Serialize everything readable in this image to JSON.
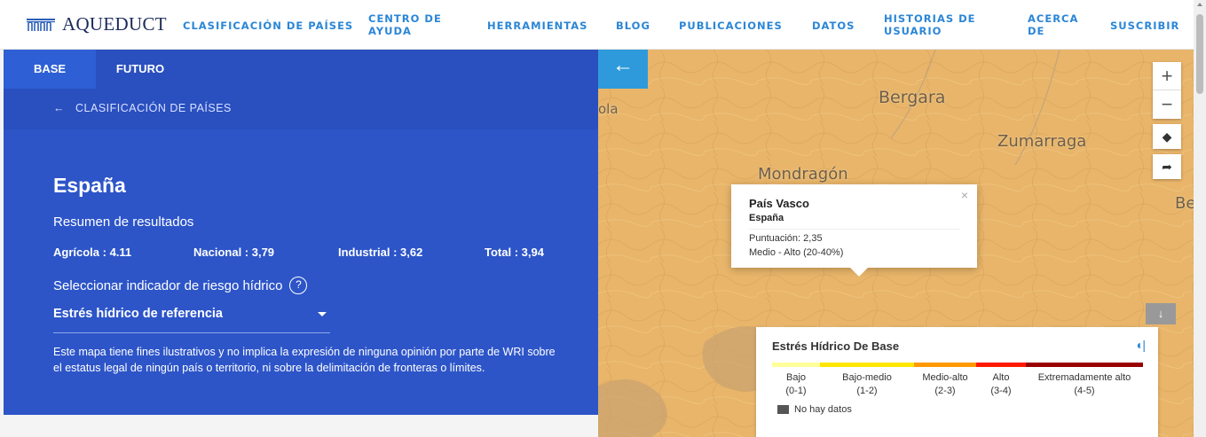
{
  "header": {
    "logo_text": "AQUEDUCT",
    "nav": [
      {
        "line1": "CLASIFICACIÓN DE PAÍSES",
        "line2": ""
      },
      {
        "line1": "CENTRO DE",
        "line2": "AYUDA"
      },
      {
        "line1": "HERRAMIENTAS",
        "line2": ""
      },
      {
        "line1": "BLOG",
        "line2": ""
      },
      {
        "line1": "PUBLICACIONES",
        "line2": ""
      },
      {
        "line1": "DATOS",
        "line2": ""
      },
      {
        "line1": "HISTORIAS DE",
        "line2": "USUARIO"
      },
      {
        "line1": "ACERCA",
        "line2": "DE"
      },
      {
        "line1": "SUSCRIBIR",
        "line2": ""
      }
    ]
  },
  "sidebar": {
    "tabs": [
      "BASE",
      "FUTURO"
    ],
    "back_arrow": "←",
    "back_label": "CLASIFICACIÓN DE PAÍSES",
    "country": "España",
    "summary_title": "Resumen de resultados",
    "scores": [
      {
        "label": "Agrícola : 4.11"
      },
      {
        "label": "Nacional : 3,79"
      },
      {
        "label": "Industrial : 3,62"
      },
      {
        "label": "Total : 3,94"
      }
    ],
    "indicator_label": "Seleccionar indicador de riesgo hídrico",
    "help_icon": "?",
    "selected_indicator": "Estrés hídrico de referencia",
    "disclaimer": "Este mapa tiene fines ilustrativos y no implica la expresión de ninguna opinión por parte de WRI sobre el estatus legal de ningún país o territorio, ni sobre la delimitación de fronteras o límites."
  },
  "map": {
    "collapse_icon": "←",
    "zoom_in": "+",
    "zoom_out": "−",
    "layers_icon": "◆",
    "share_icon": "➦",
    "towns": {
      "bergara": "Bergara",
      "zumarraga": "Zumarraga",
      "mondragon": "Mondragón",
      "ola": "ola",
      "be": "Be"
    },
    "popup": {
      "close": "×",
      "region": "País Vasco",
      "country": "España",
      "score": "Puntuación: 2,35",
      "category": "Medio - Alto (20-40%)"
    },
    "legend_toggle_icon": "↓",
    "legend": {
      "title": "Estrés Hídrico De Base",
      "info_icon": "◖|",
      "categories": [
        {
          "name": "Bajo",
          "range": "(0-1)",
          "color": "#ffff99"
        },
        {
          "name": "Bajo-medio",
          "range": "(1-2)",
          "color": "#ffe600"
        },
        {
          "name": "Medio-alto",
          "range": "(2-3)",
          "color": "#ff9900"
        },
        {
          "name": "Alto",
          "range": "(3-4)",
          "color": "#ff1900"
        },
        {
          "name": "Extremadamente alto",
          "range": "(4-5)",
          "color": "#990000"
        }
      ],
      "no_data": "No hay datos"
    }
  },
  "colors": {
    "sidebar": "#2d55c8",
    "nav_link": "#2b86d6",
    "map_base": "#e8b56a",
    "map_button": "#2e9adb"
  }
}
